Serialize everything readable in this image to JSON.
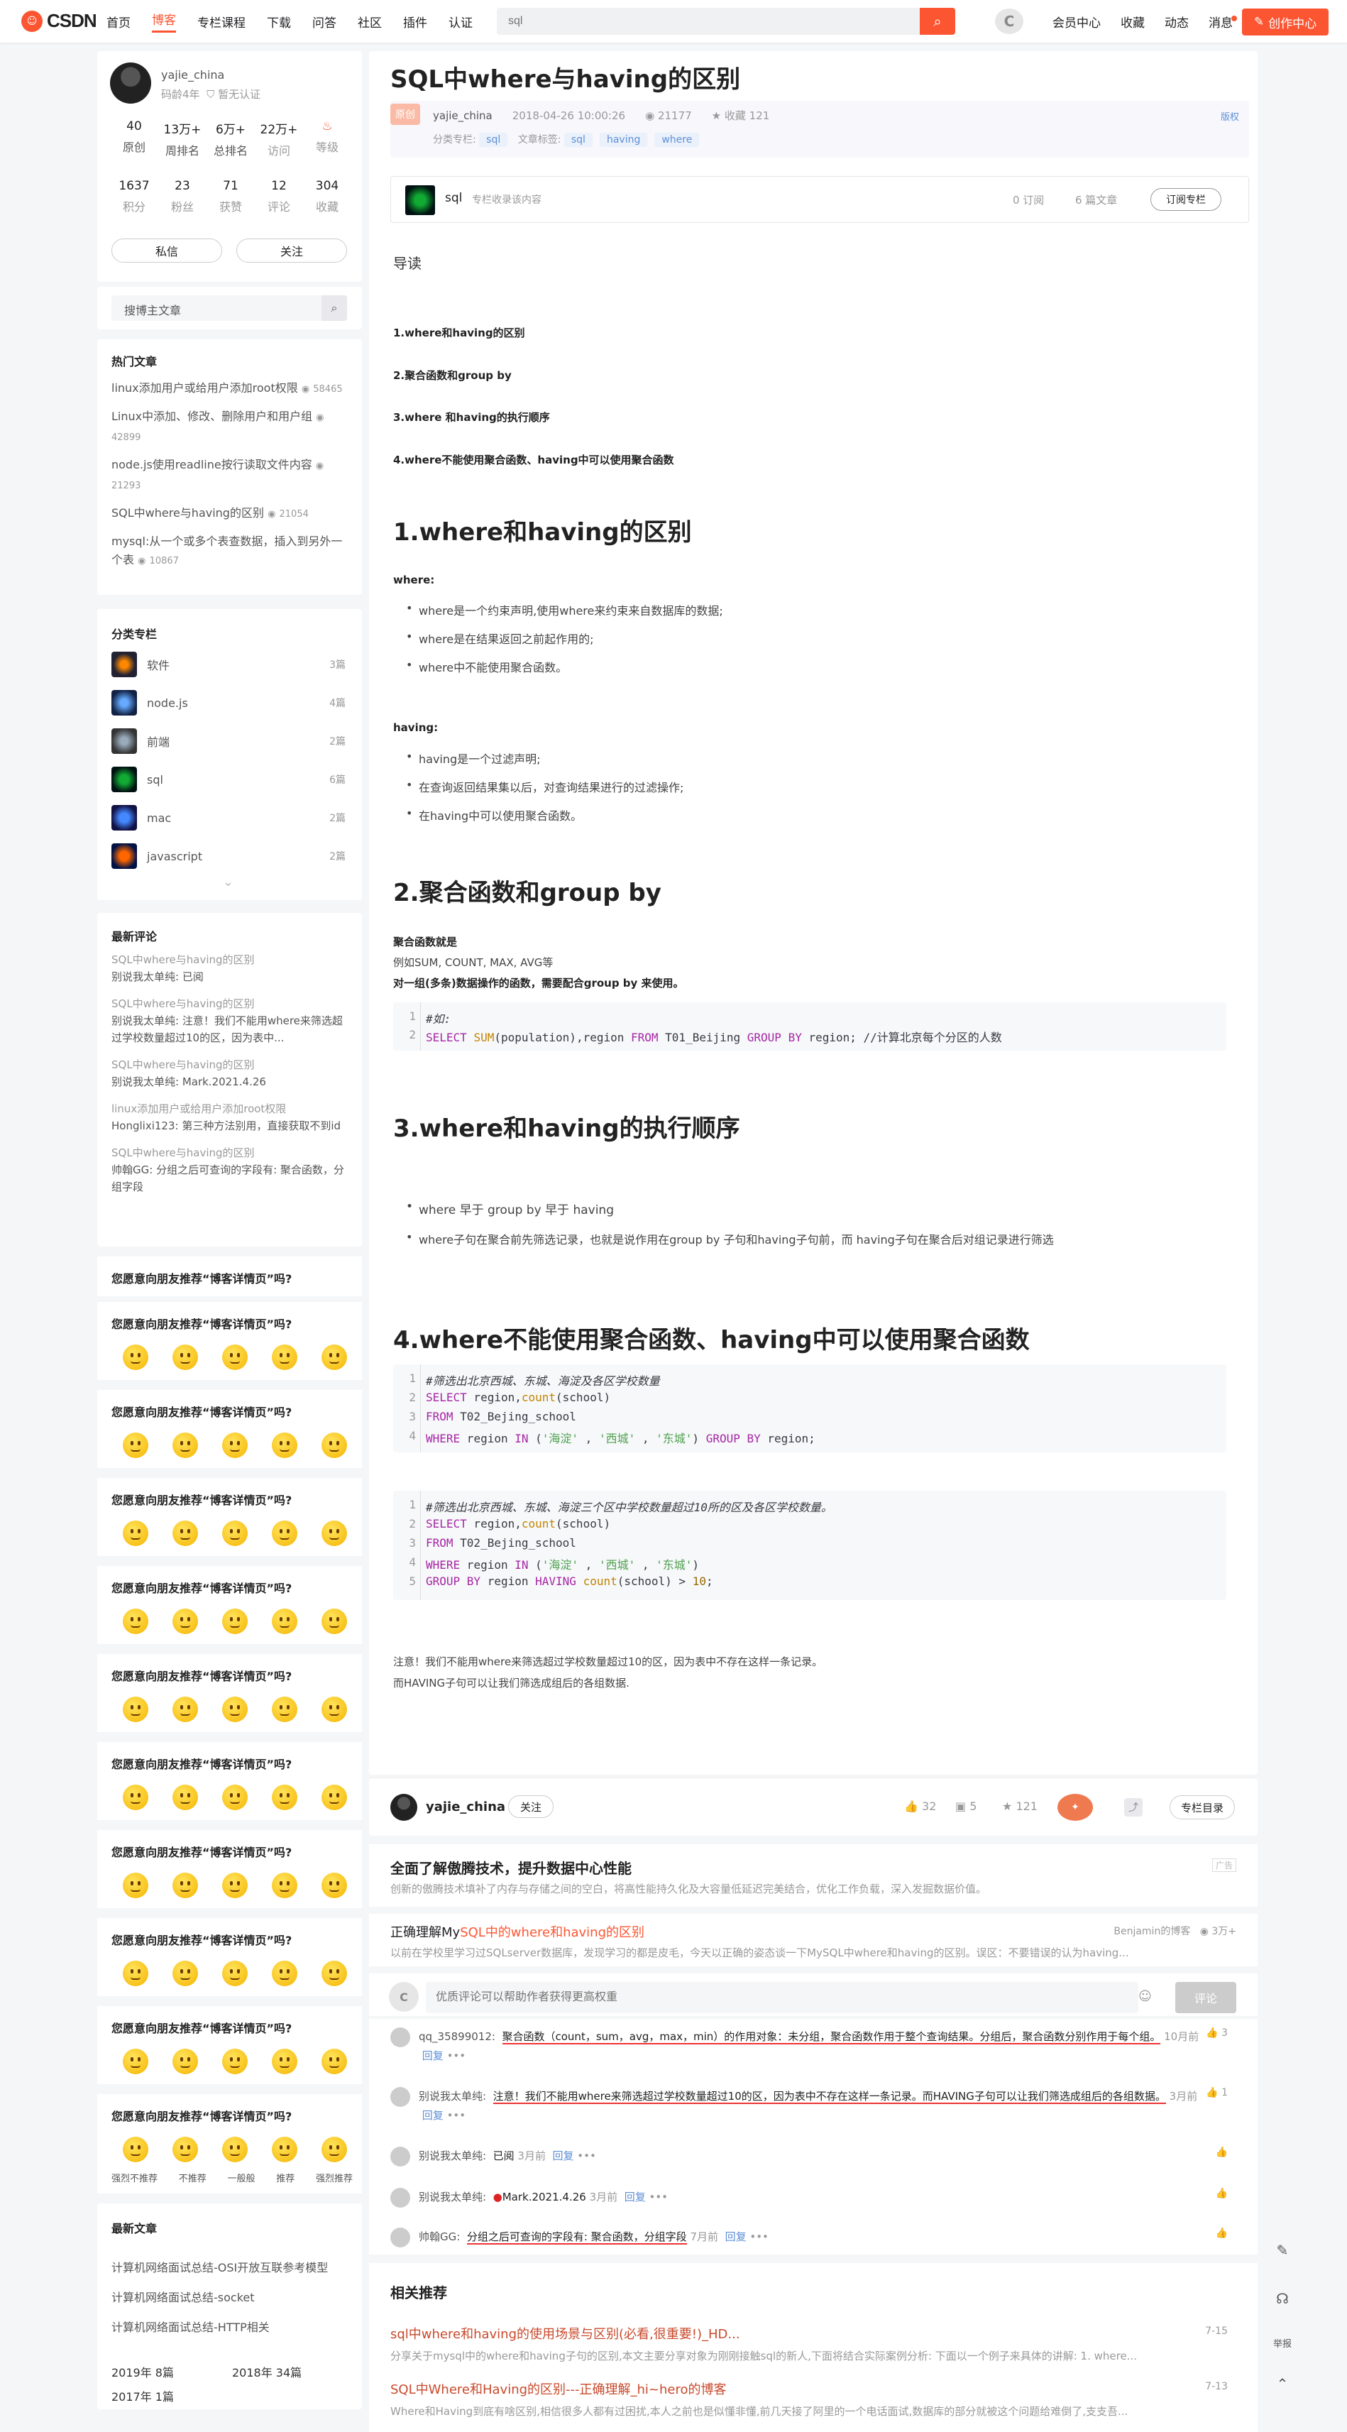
{
  "header": {
    "logo": "CSDN",
    "nav": [
      "首页",
      "博客",
      "专栏课程",
      "下载",
      "问答",
      "社区",
      "插件",
      "认证"
    ],
    "search_placeholder": "sql",
    "links": [
      "会员中心",
      "收藏",
      "动态",
      "消息"
    ],
    "create": "创作中心"
  },
  "author": {
    "name": "yajie_china",
    "age": "码龄4年",
    "cert": "暂无认证",
    "stats1": [
      {
        "n": "40",
        "l": "原创"
      },
      {
        "n": "13万+",
        "l": "周排名"
      },
      {
        "n": "6万+",
        "l": "总排名"
      },
      {
        "n": "22万+",
        "l": "访问"
      },
      {
        "n": "",
        "l": "等级"
      }
    ],
    "stats2": [
      {
        "n": "1637",
        "l": "积分"
      },
      {
        "n": "23",
        "l": "粉丝"
      },
      {
        "n": "71",
        "l": "获赞"
      },
      {
        "n": "12",
        "l": "评论"
      },
      {
        "n": "304",
        "l": "收藏"
      }
    ],
    "msg": "私信",
    "follow": "关注"
  },
  "blog_search": "搜博主文章",
  "hot": {
    "title": "热门文章",
    "items": [
      {
        "t": "linux添加用户或给用户添加root权限",
        "v": "58465"
      },
      {
        "t": "Linux中添加、修改、删除用户和用户组",
        "v": "42899"
      },
      {
        "t": "node.js使用readline按行读取文件内容",
        "v": "21293"
      },
      {
        "t": "SQL中where与having的区别",
        "v": "21054"
      },
      {
        "t": "mysql:从一个或多个表查数据，插入到另外一个表",
        "v": "10867"
      }
    ]
  },
  "cats": {
    "title": "分类专栏",
    "items": [
      {
        "n": "软件",
        "c": "3篇"
      },
      {
        "n": "node.js",
        "c": "4篇"
      },
      {
        "n": "前端",
        "c": "2篇"
      },
      {
        "n": "sql",
        "c": "6篇"
      },
      {
        "n": "mac",
        "c": "2篇"
      },
      {
        "n": "javascript",
        "c": "2篇"
      }
    ]
  },
  "recent": {
    "title": "最新评论",
    "items": [
      {
        "t": "SQL中where与having的区别",
        "c": "别说我太单纯: 已阅"
      },
      {
        "t": "SQL中where与having的区别",
        "c": "别说我太单纯: 注意！我们不能用where来筛选超过学校数量超过10的区，因为表中..."
      },
      {
        "t": "SQL中where与having的区别",
        "c": "别说我太单纯: Mark.2021.4.26"
      },
      {
        "t": "linux添加用户或给用户添加root权限",
        "c": "Honglixi123: 第三种方法别用，直接获取不到id"
      },
      {
        "t": "SQL中where与having的区别",
        "c": "帅翰GG: 分组之后可查询的字段有: 聚合函数，分组字段"
      }
    ]
  },
  "rate_q": "您愿意向朋友推荐“博客详情页”吗?",
  "rate_labels": [
    "强烈不推荐",
    "不推荐",
    "一般般",
    "推荐",
    "强烈推荐"
  ],
  "archive": {
    "title": "最新文章",
    "items": [
      "计算机网络面试总结-OSI开放互联参考模型",
      "计算机网络面试总结-socket",
      "计算机网络面试总结-HTTP相关"
    ],
    "years": [
      "2019年  8篇",
      "2018年  34篇",
      "2017年  1篇"
    ]
  },
  "article": {
    "title": "SQL中where与having的区别",
    "orig": "原创",
    "author": "yajie_china",
    "date": "2018-04-26 10:00:26",
    "views": "21177",
    "fav": "收藏 121",
    "copyright": "版权",
    "cat_label": "分类专栏:",
    "cat": "sql",
    "tag_label": "文章标签:",
    "tags": [
      "sql",
      "having",
      "where"
    ],
    "col_name": "sql",
    "col_note": "专栏收录该内容",
    "col_sub": "0 订阅",
    "col_count": "6 篇文章",
    "col_btn": "订阅专栏",
    "toc_title": "导读",
    "toc": [
      "1.where和having的区别",
      "2.聚合函数和group by",
      "3.where 和having的执行顺序",
      "4.where不能使用聚合函数、having中可以使用聚合函数"
    ],
    "h1": "1.where和having的区别",
    "where_label": "where:",
    "where_items": [
      "where是一个约束声明,使用where来约束来自数据库的数据;",
      "where是在结果返回之前起作用的;",
      "where中不能使用聚合函数。"
    ],
    "having_label": "having:",
    "having_items": [
      "having是一个过滤声明;",
      "在查询返回结果集以后，对查询结果进行的过滤操作;",
      "在having中可以使用聚合函数。"
    ],
    "h2": "2.聚合函数和group by",
    "agg1": "聚合函数就是",
    "agg2": "例如SUM, COUNT, MAX, AVG等",
    "agg3": "对一组(多条)数据操作的函数，需要配合group by 来使用。",
    "h3": "3.where和having的执行顺序",
    "order1": "where 早于 group by 早于 having",
    "order2": "where子句在聚合前先筛选记录，也就是说作用在group by 子句和having子句前，而 having子句在聚合后对组记录进行筛选",
    "h4": "4.where不能使用聚合函数、having中可以使用聚合函数",
    "note1": "注意！我们不能用where来筛选超过学校数量超过10的区，因为表中不存在这样一条记录。",
    "note2": "而HAVING子句可以让我们筛选成组后的各组数据."
  },
  "bottom": {
    "author": "yajie_china",
    "follow": "关注",
    "likes": "32",
    "comments": "5",
    "favs": "121",
    "dir": "专栏目录"
  },
  "ad": {
    "title": "全面了解傲腾技术，提升数据中心性能",
    "desc": "创新的傲腾技术填补了内存与存储之间的空白，将高性能持久化及大容量低延迟完美结合，优化工作负载，深入发掘数据价值。",
    "badge": "广告"
  },
  "rec1": {
    "title": "正确理解MySQL中的where和having的区别",
    "src": "Benjamin的博客",
    "views": "3万+",
    "desc": "以前在学校里学习过SQLserver数据库，发现学习的都是皮毛，今天以正确的姿态谈一下MySQL中where和having的区别。误区：不要错误的认为having..."
  },
  "comment_box": {
    "placeholder": "优质评论可以帮助作者获得更高权重",
    "btn": "评论"
  },
  "comments": [
    {
      "user": "qq_35899012:",
      "text": "聚合函数（count，sum，avg，max，min）的作用对象：未分组，聚合函数作用于整个查询结果。分组后，聚合函数分别作用于每个组。",
      "time": "10月前",
      "like": "3"
    },
    {
      "user": "别说我太单纯:",
      "text": "注意！我们不能用where来筛选超过学校数量超过10的区，因为表中不存在这样一条记录。而HAVING子句可以让我们筛选成组后的各组数据。",
      "time": "3月前",
      "like": "1"
    },
    {
      "user": "别说我太单纯:",
      "text": "已阅",
      "time": "3月前",
      "like": ""
    },
    {
      "user": "别说我太单纯:",
      "text": "Mark.2021.4.26",
      "time": "3月前",
      "like": ""
    },
    {
      "user": "帅翰GG:",
      "text": "分组之后可查询的字段有: 聚合函数，分组字段",
      "time": "7月前",
      "like": ""
    }
  ],
  "reply": "回复",
  "related_title": "相关推荐",
  "related": [
    {
      "title": "sql中where和having的使用场景与区别(必看,很重要!)_HD...",
      "date": "7-15",
      "desc": "分享关于mysql中的where和having子句的区别,本文主要分享对象为刚刚接触sql的新人,下面将结合实际案例分析: 下面以一个例子来具体的讲解: 1. where..."
    },
    {
      "title": "SQL中Where和Having的区别---正确理解_hi~hero的博客",
      "date": "7-13",
      "desc": "Where和Having到底有啥区别,相信很多人都有过困扰,本人之前也是似懂非懂,前几天接了阿里的一个电话面试,数据库的部分就被这个问题给难倒了,支支吾..."
    }
  ],
  "float": {
    "report": "举报"
  }
}
